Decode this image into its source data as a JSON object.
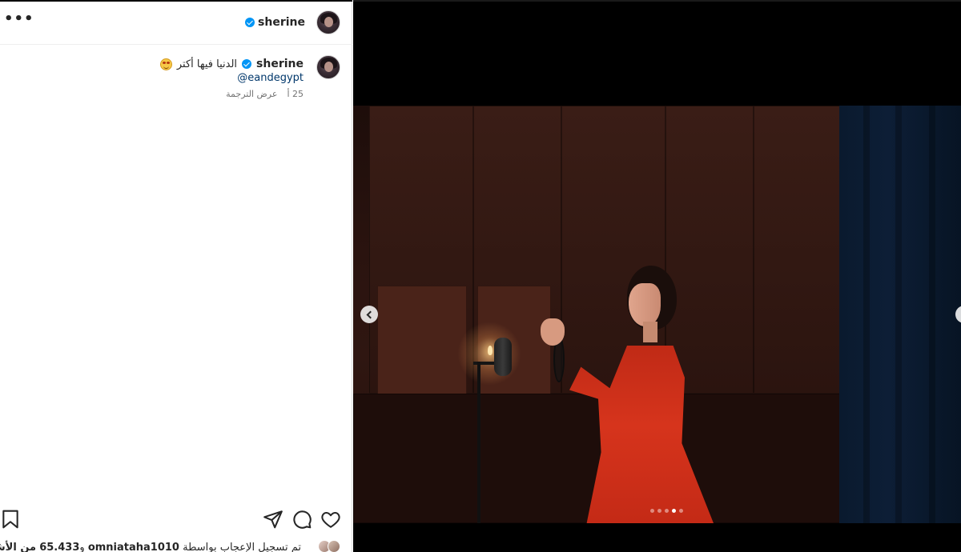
{
  "post": {
    "username": "sherine",
    "more_label": "•••",
    "caption": "الدنيا فيها أكتر",
    "mention": "@eandegypt",
    "time": "25 أ",
    "translate": "عرض الترجمة"
  },
  "likes": {
    "prefix": "تم تسجيل الإعجاب بواسطة",
    "user": "omniataha1010",
    "conj": "و",
    "count": "65.433",
    "suffix": "من الأشخاص"
  },
  "carousel": {
    "total_slides": 5,
    "active_index": 3
  },
  "colors": {
    "verified": "#0095f6",
    "text": "#262626",
    "link": "#00376b",
    "muted": "#737373"
  }
}
